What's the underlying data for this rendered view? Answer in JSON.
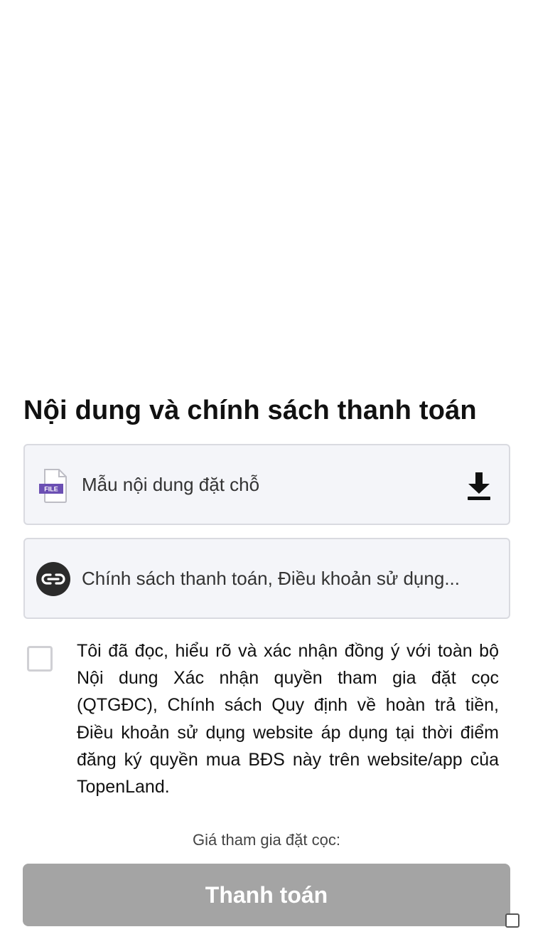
{
  "section": {
    "title": "Nội dung và chính sách thanh toán"
  },
  "file_card": {
    "icon": "file-icon",
    "icon_text": "FILE",
    "label": "Mẫu nội dung đặt chỗ",
    "action_icon": "download-icon"
  },
  "policy_card": {
    "icon": "link-icon",
    "label": "Chính sách thanh toán, Điều khoản sử dụng..."
  },
  "consent": {
    "checked": false,
    "text": "Tôi đã đọc, hiểu rõ và xác nhận đồng ý với toàn bộ Nội dung Xác nhận quyền tham gia đặt cọc (QTGĐC), Chính sách Quy định về hoàn trả tiền, Điều khoản sử dụng website áp dụng tại thời điểm đăng ký quyền mua BĐS này trên website/app của TopenLand."
  },
  "deposit": {
    "label": "Giá tham gia đặt cọc:"
  },
  "actions": {
    "pay_label": "Thanh toán"
  },
  "colors": {
    "card_bg": "#f4f5f9",
    "card_border": "#d9dae0",
    "button_disabled": "#a4a4a4",
    "file_badge": "#6b4fb3",
    "link_icon_bg": "#2b2b2b"
  }
}
